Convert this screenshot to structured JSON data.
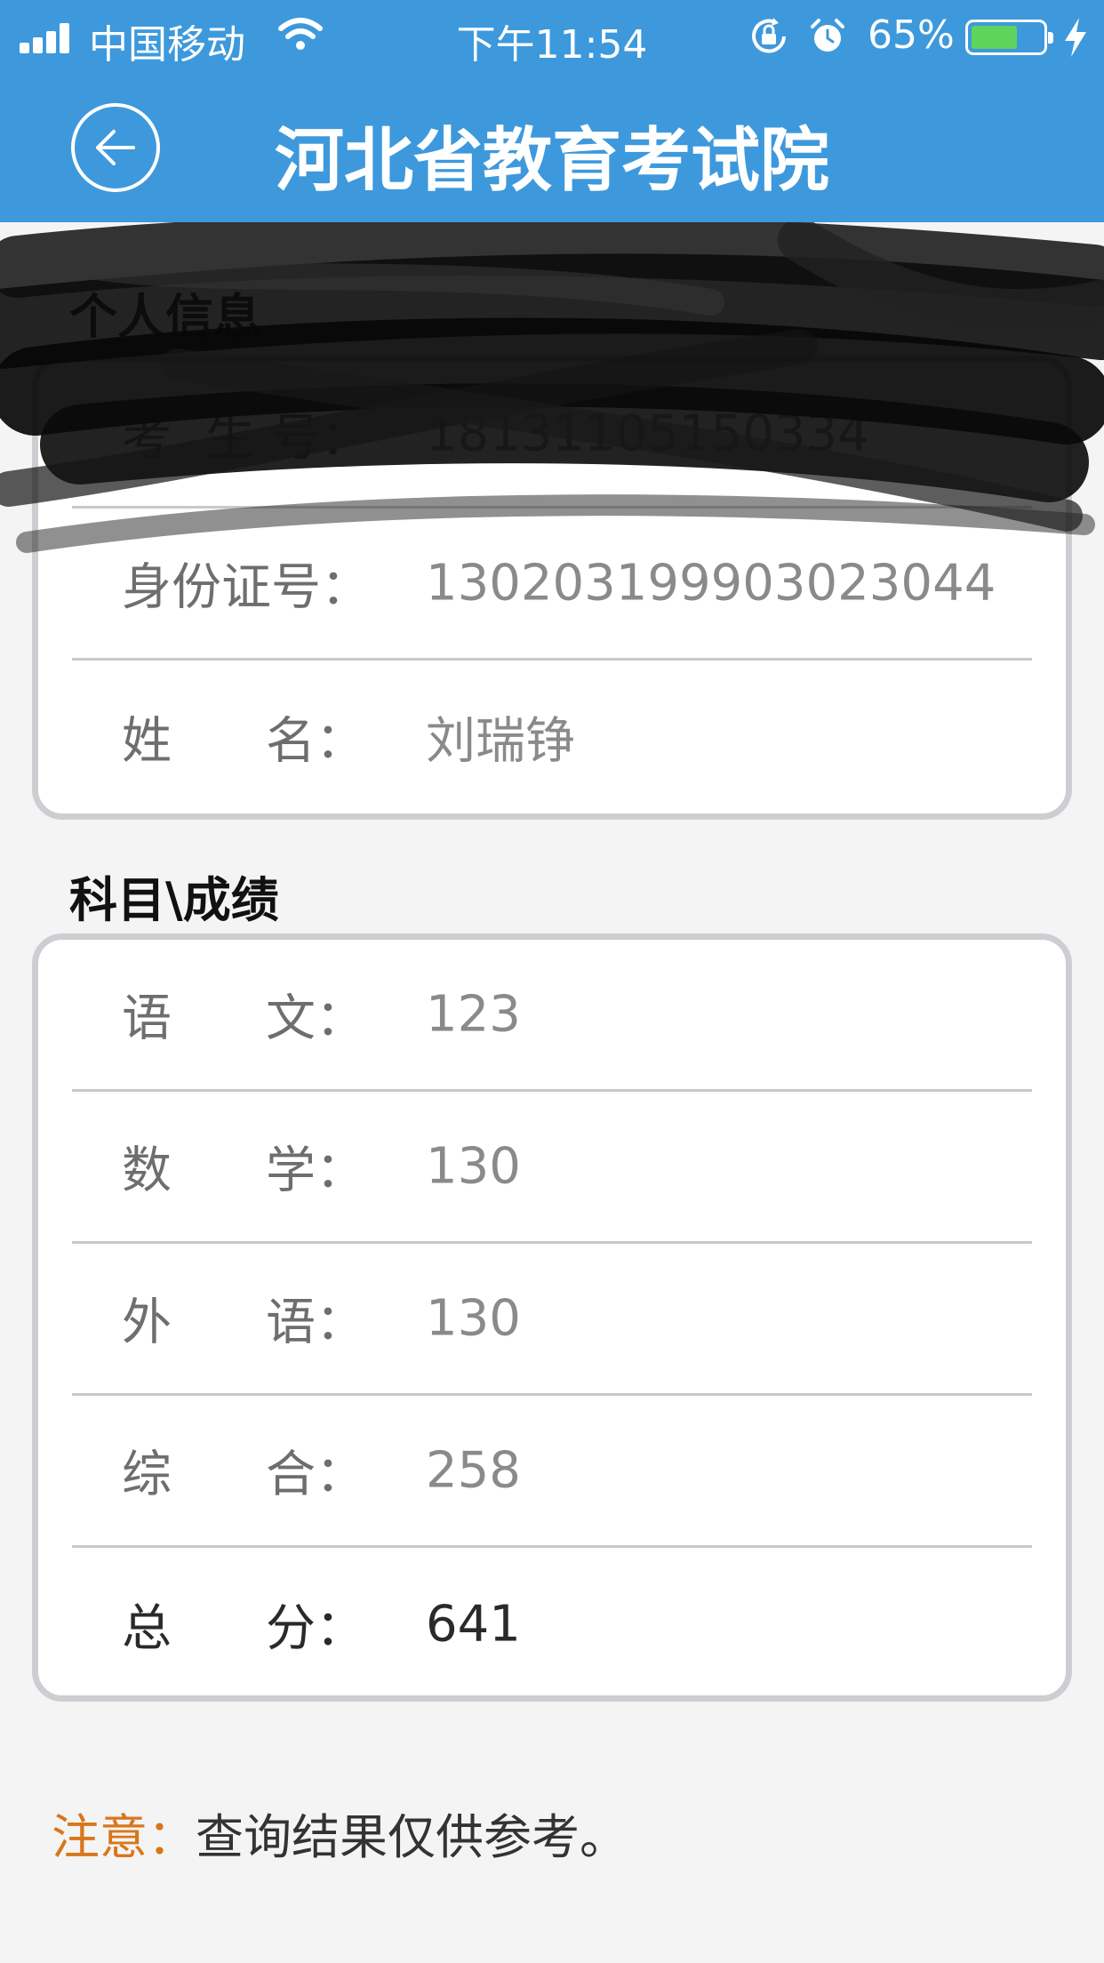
{
  "status_bar": {
    "carrier": "中国移动",
    "time": "下午11:54",
    "battery_percent": "65%",
    "battery_level": 0.65,
    "icons": [
      "signal-icon",
      "wifi-icon",
      "orientation-lock-icon",
      "alarm-icon",
      "battery-icon",
      "charging-bolt-icon"
    ]
  },
  "nav": {
    "title": "河北省教育考试院",
    "back_icon": "back-arrow-icon"
  },
  "personal_info": {
    "section_title": "个人信息",
    "rows": [
      {
        "k1": "考",
        "k2": "生  号：",
        "value": "18131105150334"
      },
      {
        "k1": "身份证号：",
        "k2": "",
        "value": "130203199903023044"
      },
      {
        "k1": "姓",
        "k2": "名：",
        "value": "刘瑞铮"
      }
    ]
  },
  "scores": {
    "section_title": "科目\\成绩",
    "rows": [
      {
        "k1": "语",
        "k2": "文：",
        "value": "123"
      },
      {
        "k1": "数",
        "k2": "学：",
        "value": "130"
      },
      {
        "k1": "外",
        "k2": "语：",
        "value": "130"
      },
      {
        "k1": "综",
        "k2": "合：",
        "value": "258"
      },
      {
        "k1": "总",
        "k2": "分：",
        "value": "641"
      }
    ]
  },
  "note": {
    "label": "注意：",
    "text": "查询结果仅供参考。"
  },
  "colors": {
    "header_blue": "#3d99dc",
    "note_orange": "#d9761a",
    "battery_green": "#5ed45c"
  }
}
